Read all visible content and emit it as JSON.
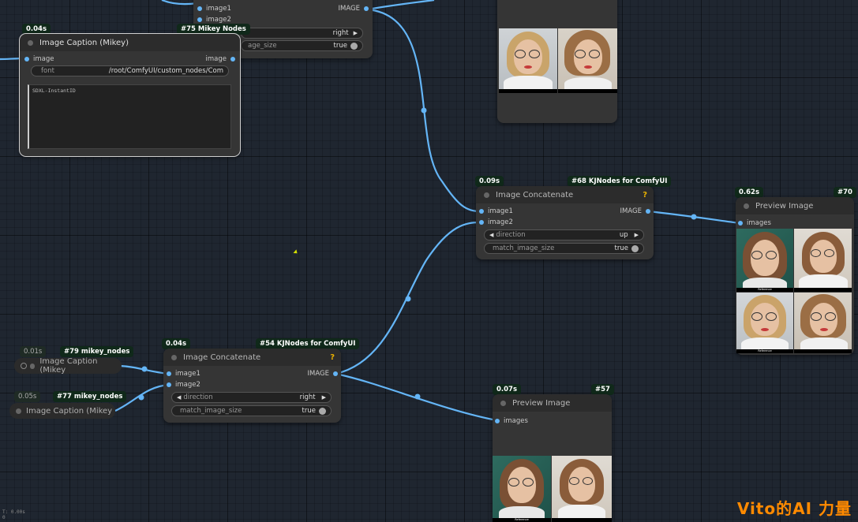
{
  "nodes": {
    "caption75": {
      "time": "0.04s",
      "id_badge": "#75 Mikey Nodes",
      "title": "Image Caption (Mikey)",
      "input_label": "image",
      "output_label": "image",
      "font_label": "font",
      "font_value": "/root/ComfyUI/custom_nodes/Com",
      "text_value": "SDXL-InstantID"
    },
    "topNode": {
      "input1": "image1",
      "input2": "image2",
      "output": "IMAGE",
      "direction_value": "right",
      "match_label": "age_size",
      "match_value": "true"
    },
    "concat68": {
      "time": "0.09s",
      "id_badge": "#68 KJNodes for ComfyUI",
      "title": "Image Concatenate",
      "help": "?",
      "input1": "image1",
      "input2": "image2",
      "output": "IMAGE",
      "direction_label": "direction",
      "direction_value": "up",
      "match_label": "match_image_size",
      "match_value": "true"
    },
    "preview70": {
      "time": "0.62s",
      "id_badge": "#70",
      "title": "Preview Image",
      "input": "images",
      "cap_ref_1": "Reference",
      "cap_ref_2": "Reference"
    },
    "concat54": {
      "time": "0.04s",
      "id_badge": "#54 KJNodes for ComfyUI",
      "title": "Image Concatenate",
      "help": "?",
      "input1": "image1",
      "input2": "image2",
      "output": "IMAGE",
      "direction_label": "direction",
      "direction_value": "right",
      "match_label": "match_image_size",
      "match_value": "true"
    },
    "preview57": {
      "time": "0.07s",
      "id_badge": "#57",
      "title": "Preview Image",
      "input": "images",
      "cap_ref": "Reference"
    },
    "collapsed79": {
      "time": "0.01s",
      "id_badge": "#79 mikey_nodes",
      "title": "Image Caption (Mikey"
    },
    "collapsed77": {
      "time": "0.05s",
      "id_badge": "#77 mikey_nodes",
      "title": "Image Caption (Mikey"
    }
  },
  "watermark": {
    "prefix": "Vito的",
    "ai": "AI",
    "suffix": " 力量"
  },
  "corner_stats": {
    "line1": "T: 0.00s",
    "line2": "0"
  },
  "colors": {
    "link": "#64b5f6",
    "badge_bg": "#10291a",
    "node_bg": "#353535",
    "canvas_bg": "#1f2630",
    "watermark": "#ff8a00"
  }
}
